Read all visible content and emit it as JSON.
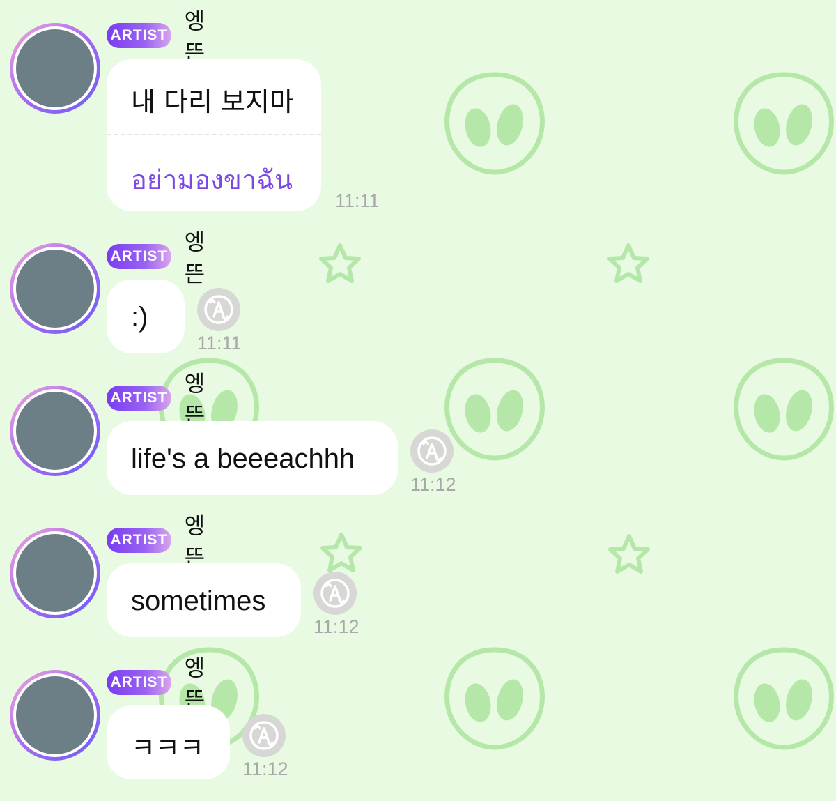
{
  "theme": {
    "background": "#e8fbe2",
    "pattern_color": "#b5e8a8",
    "badge_gradient": [
      "#7a3cf0",
      "#d9a6ee"
    ],
    "translation_color": "#7b48e6",
    "time_color": "#a8a8a8"
  },
  "messages": [
    {
      "badge": "ARTIST",
      "sender": "엥뜬",
      "text": "내 다리 보지마",
      "translation": "อย่ามองขาฉัน",
      "time": "11:11",
      "icons": [
        "avatar"
      ]
    },
    {
      "badge": "ARTIST",
      "sender": "엥뜬",
      "text": ":)",
      "time": "11:11",
      "icons": [
        "avatar",
        "translate-icon"
      ]
    },
    {
      "badge": "ARTIST",
      "sender": "엥뜬",
      "text": "life's a beeeachhh",
      "time": "11:12",
      "icons": [
        "avatar",
        "translate-icon"
      ]
    },
    {
      "badge": "ARTIST",
      "sender": "엥뜬",
      "text": "sometimes",
      "time": "11:12",
      "icons": [
        "avatar",
        "translate-icon"
      ]
    },
    {
      "badge": "ARTIST",
      "sender": "엥뜬",
      "text": "ㅋㅋㅋ",
      "time": "11:12",
      "icons": [
        "avatar",
        "translate-icon"
      ]
    }
  ]
}
